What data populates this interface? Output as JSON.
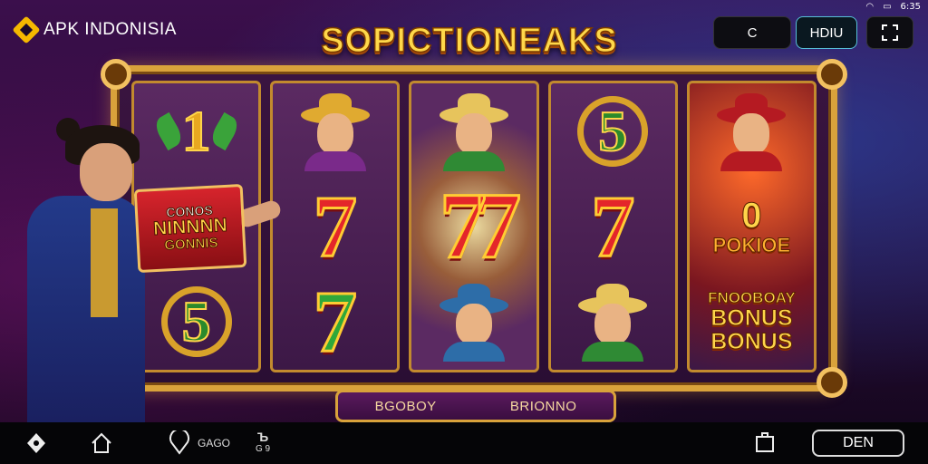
{
  "status_bar": {
    "time": "6:35"
  },
  "header": {
    "brand": "APK INDONISIA",
    "title": "SOPICTIONEAKS",
    "buttons": [
      {
        "label": "C",
        "icon": "circle-icon"
      },
      {
        "label": "HDIU"
      },
      {
        "label": "",
        "icon": "expand-icon"
      }
    ]
  },
  "promo": {
    "line1": "CONOS",
    "line2": "NINNNN",
    "line3": "GONNIS"
  },
  "reels": [
    [
      "1",
      "CONOS NINNNN GONNIS",
      "5"
    ],
    [
      "queen",
      "7",
      "7"
    ],
    [
      "cowboy",
      "77",
      "scarf-girl"
    ],
    [
      "5",
      "7",
      "cowboy"
    ],
    [
      "red-hood",
      "0",
      "FNOOBOAY BONUS BONUS"
    ]
  ],
  "reel_texts": {
    "poker_o": "0",
    "poker": "POKIOE",
    "bonus_line1": "FNOOBOAY",
    "bonus_line2": "BONUS",
    "bonus_line3": "BONUS"
  },
  "plaque": {
    "left": "BGOBOY",
    "right": "BRIONNO"
  },
  "bottom_bar": {
    "items": [
      {
        "icon": "shield-icon"
      },
      {
        "icon": "home-icon"
      },
      {
        "icon": "location-icon",
        "label": "GAGO"
      },
      {
        "icon": "tool-icon",
        "label": "G 9"
      },
      {
        "icon": "save-icon"
      }
    ],
    "action_button": "DEN"
  }
}
